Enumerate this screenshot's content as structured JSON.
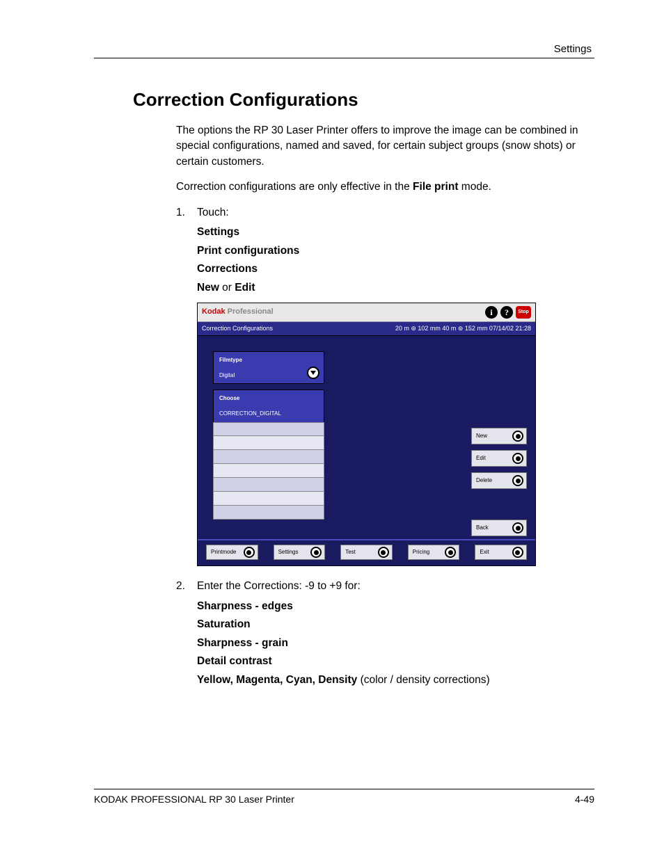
{
  "header": {
    "right": "Settings"
  },
  "title": "Correction Configurations",
  "intro1": "The options the RP 30 Laser Printer offers to improve the image can be combined in special configurations, named and saved, for certain subject groups (snow shots) or certain customers.",
  "intro2_a": "Correction configurations are only effective in the ",
  "intro2_b": "File print",
  "intro2_c": " mode.",
  "step1": {
    "num": "1.",
    "label": "Touch:",
    "items": [
      "Settings",
      "Print configurations",
      "Corrections"
    ],
    "last_a": "New",
    "last_mid": " or ",
    "last_b": "Edit"
  },
  "step2": {
    "num": "2.",
    "label": "Enter the Corrections: -9 to  +9 for:",
    "items": [
      "Sharpness - edges",
      "Saturation",
      "Sharpness - grain",
      "Detail contrast"
    ],
    "last_a": "Yellow, Magenta, Cyan, Density",
    "last_b": " (color / density corrections)"
  },
  "shot": {
    "brand_k": "Kodak",
    "brand_p": " Professional",
    "info_glyph": "i",
    "help_glyph": "?",
    "stop": "Stop",
    "title": "Correction Configurations",
    "status": "20 m ⊚ 102 mm   40 m ⊚ 152 mm  07/14/02     21:28",
    "filmtype_label": "Filmtype",
    "filmtype_value": "Digital",
    "choose_label": "Choose",
    "choose_value": "CORRECTION_DIGITAL",
    "side": {
      "new": "New",
      "edit": "Edit",
      "delete": "Delete",
      "back": "Back"
    },
    "footer": {
      "printmode": "Printmode",
      "settings": "Settings",
      "test": "Test",
      "pricing": "Pricing",
      "exit": "Exit"
    }
  },
  "footer": {
    "left": "KODAK PROFESSIONAL RP 30 Laser Printer",
    "right": "4-49"
  }
}
